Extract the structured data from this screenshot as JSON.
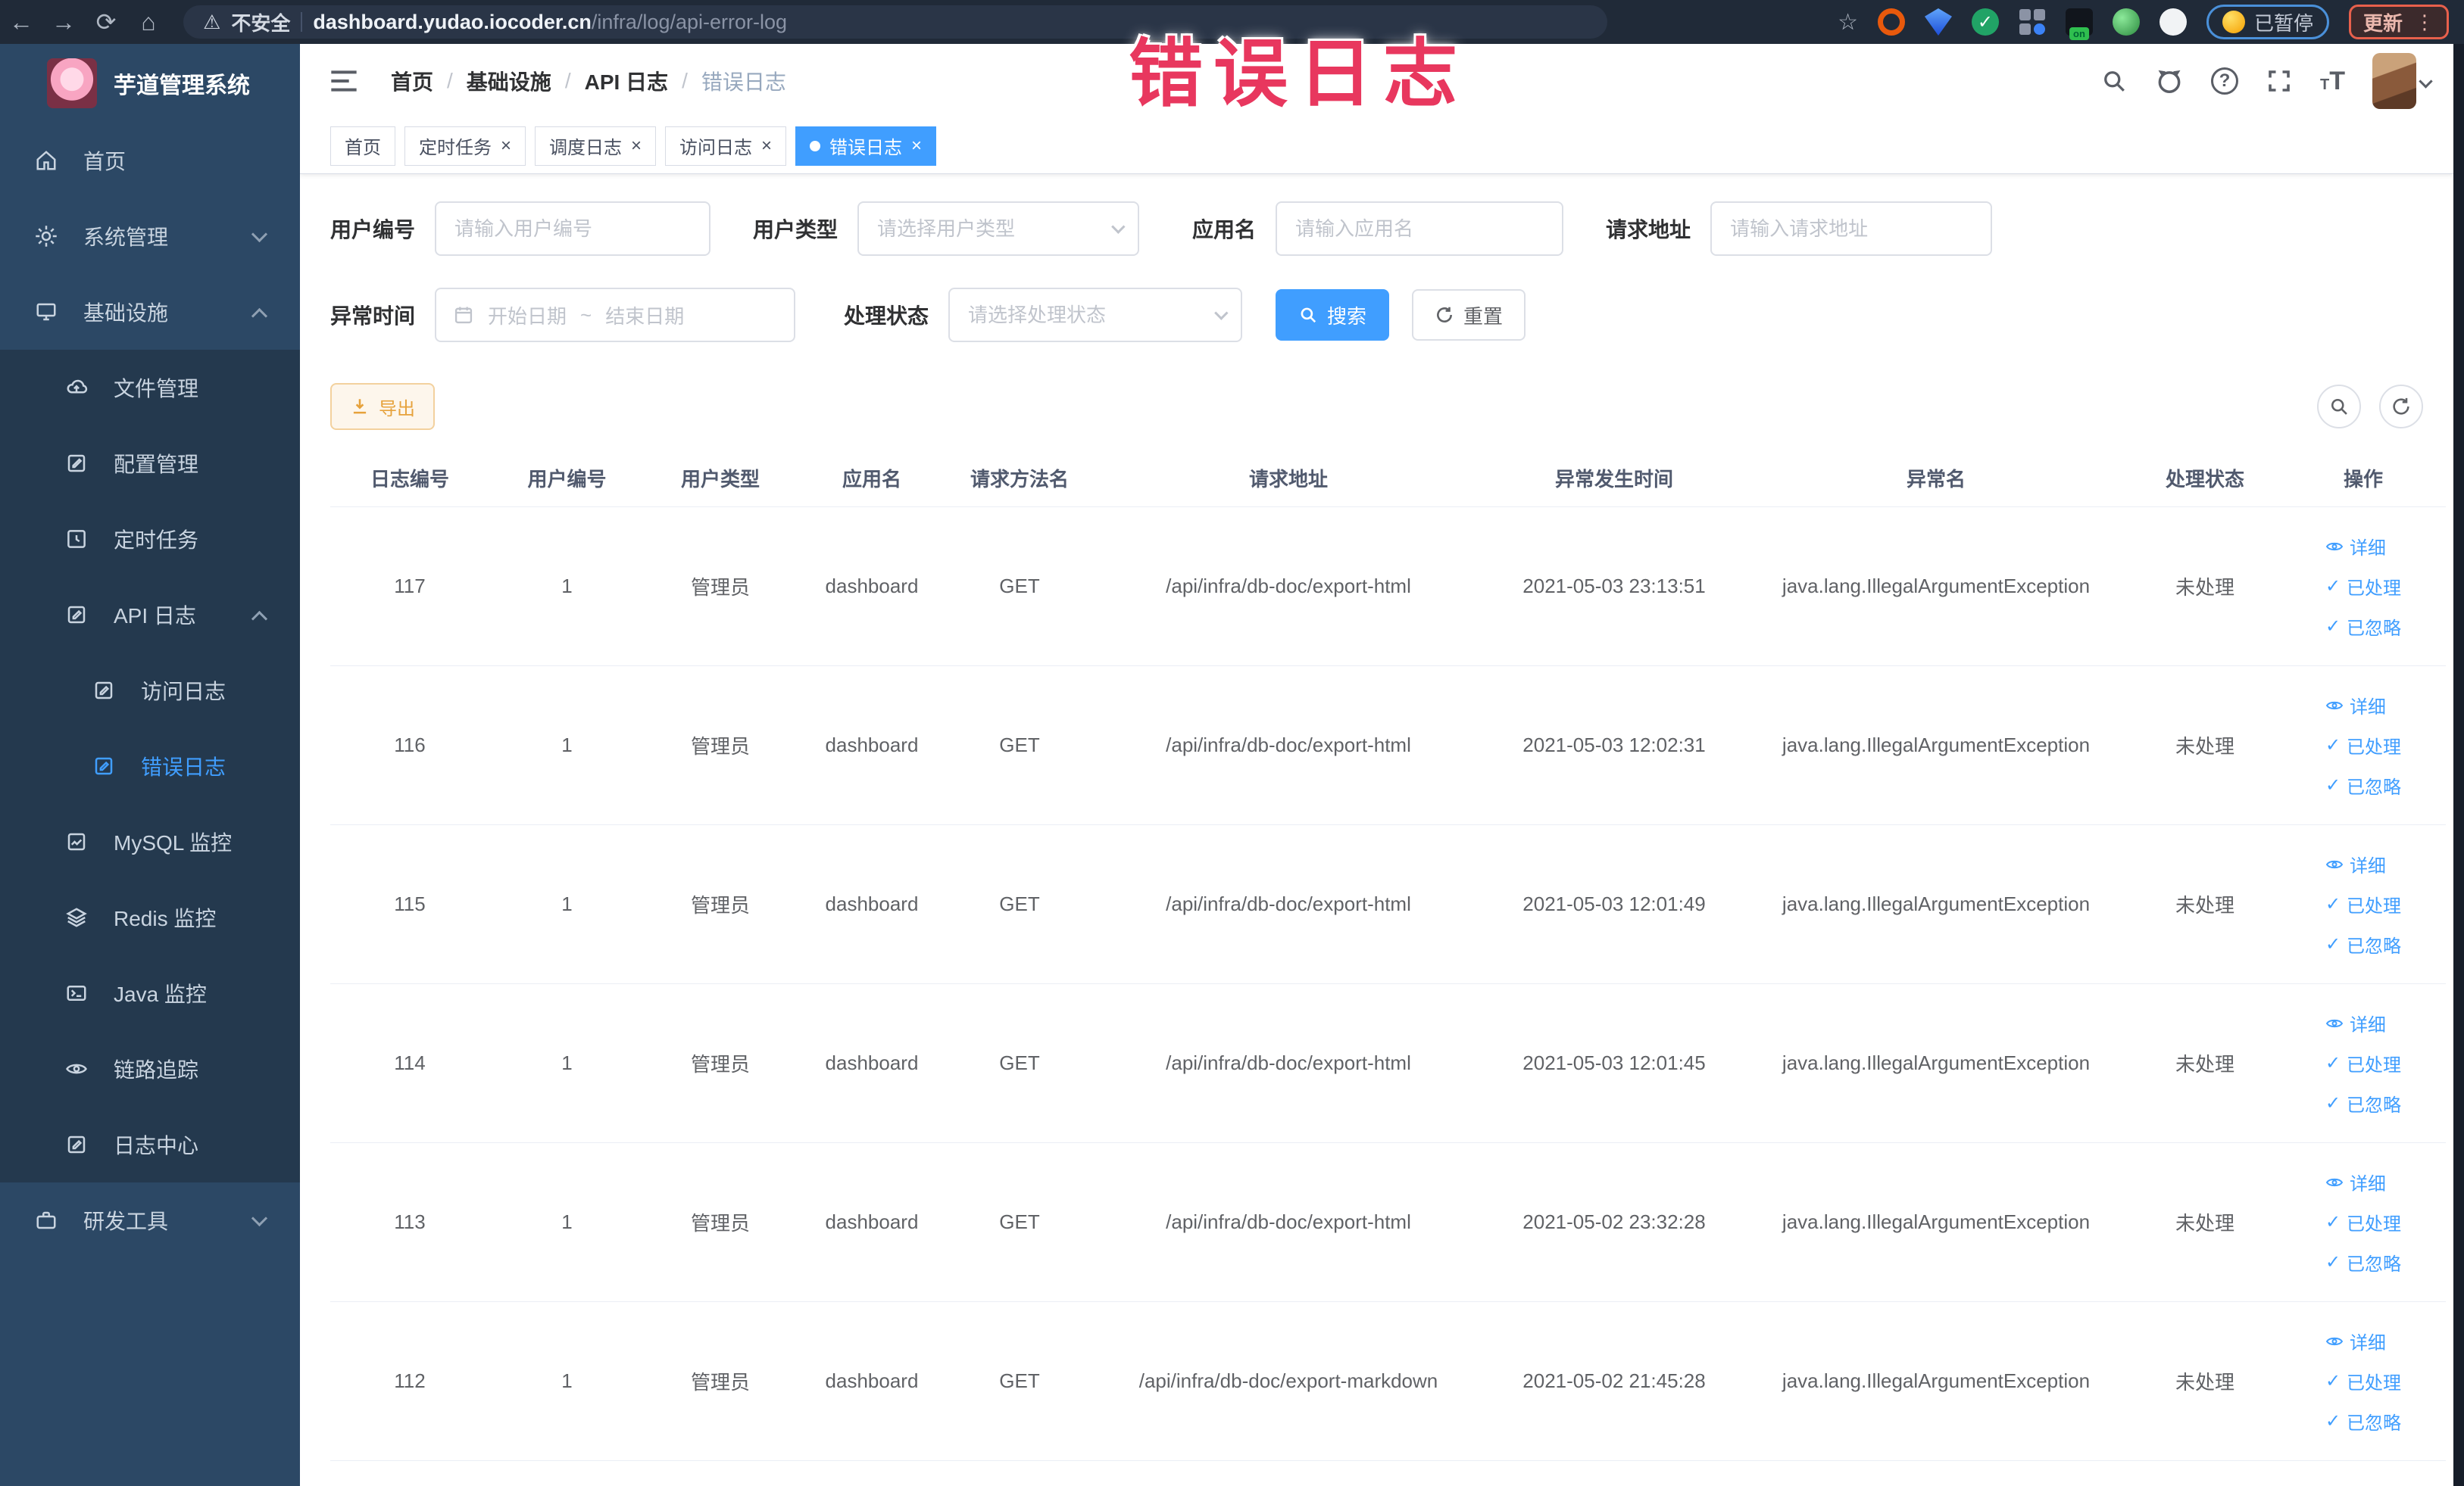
{
  "theme": {
    "accent": "#409eff",
    "warning": "#e6a23c",
    "chrome_bg": "#202a38",
    "sidebar_bg": "#2c4865",
    "sidebar_submenu_bg": "#24394e",
    "annotation_pink": "#e8375e"
  },
  "browser": {
    "security_label": "不安全",
    "url_host": "dashboard.yudao.iocoder.cn",
    "url_path": "/infra/log/api-error-log",
    "paused_label": "已暂停",
    "update_label": "更新"
  },
  "overlay": {
    "title": "错误日志"
  },
  "sidebar": {
    "app_title": "芋道管理系统",
    "home": "首页",
    "system": "系统管理",
    "infra": "基础设施",
    "file": "文件管理",
    "config": "配置管理",
    "job": "定时任务",
    "api_log": "API 日志",
    "access_log": "访问日志",
    "error_log": "错误日志",
    "mysql": "MySQL 监控",
    "redis": "Redis 监控",
    "java": "Java 监控",
    "trace": "链路追踪",
    "log_center": "日志中心",
    "devtool": "研发工具"
  },
  "breadcrumb": {
    "0": "首页",
    "1": "基础设施",
    "2": "API 日志",
    "3": "错误日志",
    "sep": "/"
  },
  "tabs": [
    {
      "label": "首页"
    },
    {
      "label": "定时任务"
    },
    {
      "label": "调度日志"
    },
    {
      "label": "访问日志"
    },
    {
      "label": "错误日志"
    }
  ],
  "ui": {
    "close_glyph": "×",
    "check_glyph": "✓",
    "help_glyph": "?"
  },
  "filters": {
    "user_id": {
      "label": "用户编号",
      "placeholder": "请输入用户编号",
      "value": ""
    },
    "user_type": {
      "label": "用户类型",
      "placeholder": "请选择用户类型"
    },
    "app_name": {
      "label": "应用名",
      "placeholder": "请输入应用名",
      "value": ""
    },
    "request_url": {
      "label": "请求地址",
      "placeholder": "请输入请求地址",
      "value": ""
    },
    "exception_time": {
      "label": "异常时间",
      "start_placeholder": "开始日期",
      "separator": "~",
      "end_placeholder": "结束日期"
    },
    "process_status": {
      "label": "处理状态",
      "placeholder": "请选择处理状态"
    },
    "search_label": "搜索",
    "reset_label": "重置"
  },
  "toolbar": {
    "export_label": "导出"
  },
  "table": {
    "columns": [
      "日志编号",
      "用户编号",
      "用户类型",
      "应用名",
      "请求方法名",
      "请求地址",
      "异常发生时间",
      "异常名",
      "处理状态",
      "操作"
    ],
    "actions": {
      "detail": "详细",
      "processed": "已处理",
      "ignored": "已忽略"
    },
    "rows": [
      {
        "id": "117",
        "user_id": "1",
        "user_type": "管理员",
        "app": "dashboard",
        "method": "GET",
        "url": "/api/infra/db-doc/export-html",
        "time": "2021-05-03 23:13:51",
        "exception": "java.lang.IllegalArgumentException",
        "status": "未处理"
      },
      {
        "id": "116",
        "user_id": "1",
        "user_type": "管理员",
        "app": "dashboard",
        "method": "GET",
        "url": "/api/infra/db-doc/export-html",
        "time": "2021-05-03 12:02:31",
        "exception": "java.lang.IllegalArgumentException",
        "status": "未处理"
      },
      {
        "id": "115",
        "user_id": "1",
        "user_type": "管理员",
        "app": "dashboard",
        "method": "GET",
        "url": "/api/infra/db-doc/export-html",
        "time": "2021-05-03 12:01:49",
        "exception": "java.lang.IllegalArgumentException",
        "status": "未处理"
      },
      {
        "id": "114",
        "user_id": "1",
        "user_type": "管理员",
        "app": "dashboard",
        "method": "GET",
        "url": "/api/infra/db-doc/export-html",
        "time": "2021-05-03 12:01:45",
        "exception": "java.lang.IllegalArgumentException",
        "status": "未处理"
      },
      {
        "id": "113",
        "user_id": "1",
        "user_type": "管理员",
        "app": "dashboard",
        "method": "GET",
        "url": "/api/infra/db-doc/export-html",
        "time": "2021-05-02 23:32:28",
        "exception": "java.lang.IllegalArgumentException",
        "status": "未处理"
      },
      {
        "id": "112",
        "user_id": "1",
        "user_type": "管理员",
        "app": "dashboard",
        "method": "GET",
        "url": "/api/infra/db-doc/export-markdown",
        "time": "2021-05-02 21:45:28",
        "exception": "java.lang.IllegalArgumentException",
        "status": "未处理"
      }
    ]
  }
}
